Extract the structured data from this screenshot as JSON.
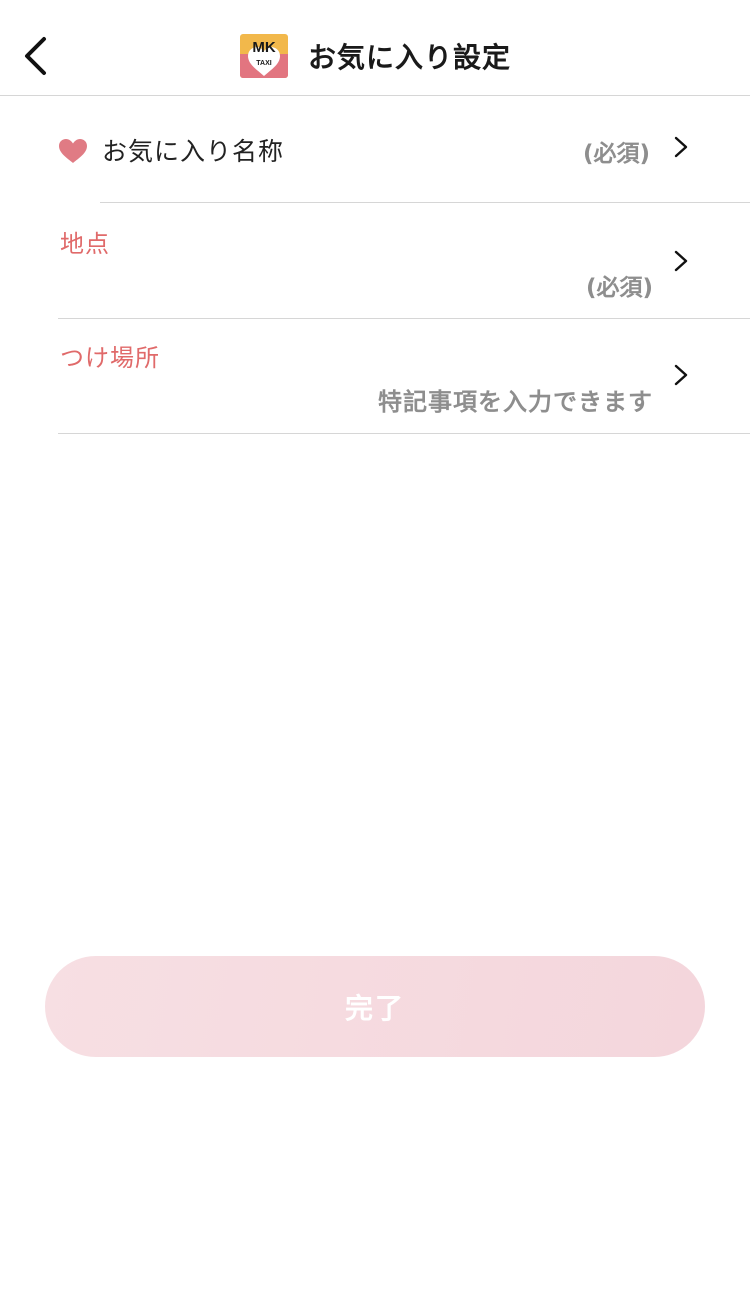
{
  "header": {
    "title": "お気に入り設定",
    "logo_text": "MK",
    "logo_subtext": "TAXI"
  },
  "form": {
    "favorite_name": {
      "label": "お気に入り名称",
      "required_label": "(必須)"
    },
    "location": {
      "label": "地点",
      "required_label": "(必須)"
    },
    "pickup_spot": {
      "label": "つけ場所",
      "placeholder": "特記事項を入力できます"
    }
  },
  "done_button": {
    "label": "完了",
    "enabled": false
  },
  "colors": {
    "accent_label": "#e06a6a",
    "heart": "#e07b84",
    "secondary_text": "#8e8e8e",
    "divider": "#d6d6d6",
    "button_disabled": "#f5d9de",
    "logo_yellow": "#f2b84b",
    "logo_pink": "#e27580"
  },
  "icons": {
    "back": "back-chevron-icon",
    "favorite": "heart-icon",
    "row_navigation": "chevron-right-icon"
  }
}
